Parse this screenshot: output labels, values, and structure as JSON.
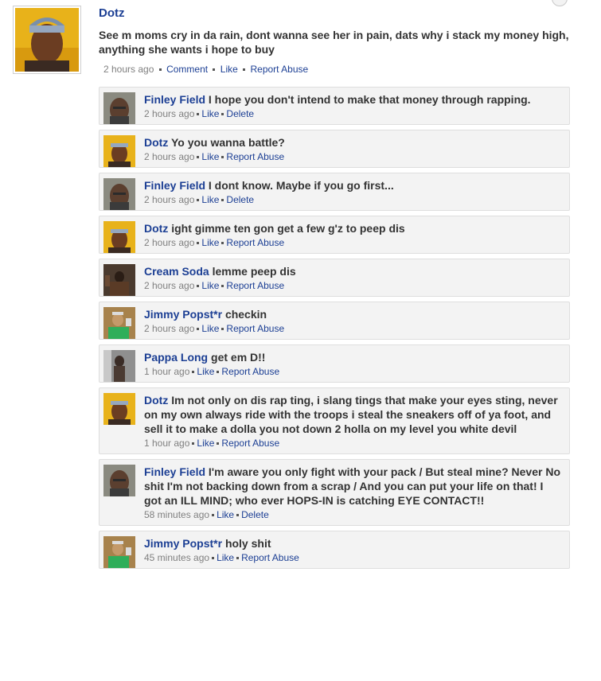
{
  "post": {
    "author": "Dotz",
    "text": "See m moms cry in da rain, dont wanna see her in pain, dats why i stack  my money high, anything she wants i hope to buy",
    "time": "2 hours ago",
    "actions": [
      "Comment",
      "Like",
      "Report Abuse"
    ]
  },
  "comments": [
    {
      "author": "Finley Field",
      "text": "I hope you don't intend to make that money through rapping.",
      "time": "2 hours ago",
      "actions": [
        "Like",
        "Delete"
      ],
      "avatar": "finley"
    },
    {
      "author": "Dotz",
      "text": "Yo you wanna battle?",
      "time": "2 hours ago",
      "actions": [
        "Like",
        "Report Abuse"
      ],
      "avatar": "dotz"
    },
    {
      "author": "Finley Field",
      "text": "I dont know. Maybe if you go first...",
      "time": "2 hours ago",
      "actions": [
        "Like",
        "Delete"
      ],
      "avatar": "finley"
    },
    {
      "author": "Dotz",
      "text": "ight gimme ten gon get a few g'z to peep dis",
      "time": "2 hours ago",
      "actions": [
        "Like",
        "Report Abuse"
      ],
      "avatar": "dotz"
    },
    {
      "author": "Cream Soda",
      "text": "lemme peep dis",
      "time": "2 hours ago",
      "actions": [
        "Like",
        "Report Abuse"
      ],
      "avatar": "cream"
    },
    {
      "author": "Jimmy Popst*r",
      "text": "checkin",
      "time": "2 hours ago",
      "actions": [
        "Like",
        "Report Abuse"
      ],
      "avatar": "jimmy"
    },
    {
      "author": "Pappa Long",
      "text": "get em D!!",
      "time": "1 hour ago",
      "actions": [
        "Like",
        "Report Abuse"
      ],
      "avatar": "pappa"
    },
    {
      "author": "Dotz",
      "text": "Im not only on dis rap ting, i slang tings that make your eyes sting, never on my own always ride with the troops i steal the sneakers off of ya foot, and sell it to make a dolla you not down 2 holla on my level you white devil",
      "time": "1 hour ago",
      "actions": [
        "Like",
        "Report Abuse"
      ],
      "avatar": "dotz"
    },
    {
      "author": "Finley Field",
      "text": "I'm aware you only fight with your pack / But steal mine? Never No shit I'm not backing down from a scrap / And you can put your life on that! I got an ILL MIND; who ever HOPS-IN is catching EYE CONTACT!!",
      "time": "58 minutes ago",
      "actions": [
        "Like",
        "Delete"
      ],
      "avatar": "finley"
    },
    {
      "author": "Jimmy Popst*r",
      "text": "holy shit",
      "time": "45 minutes ago",
      "actions": [
        "Like",
        "Report Abuse"
      ],
      "avatar": "jimmy"
    }
  ]
}
